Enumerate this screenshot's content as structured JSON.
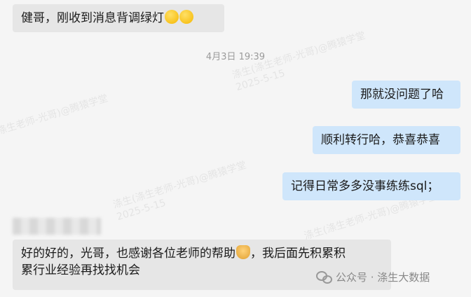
{
  "messages": [
    {
      "text": "健哥，刚收到消息背调绿灯",
      "emoji": [
        "laugh-cry-emoji",
        "laugh-cry-emoji"
      ]
    },
    {
      "text": "那就没问题了哈"
    },
    {
      "text": "顺利转行哈，恭喜恭喜"
    },
    {
      "text": "记得日常多多没事练练sql；"
    },
    {
      "line1": "好的好的，光哥，也感谢各位老师的帮助",
      "emoji": "pray-emoji",
      "line1b": "，我后面先积累积",
      "line2": "累行业经验再找找机会"
    }
  ],
  "timestamp": "4月3日 19:39",
  "watermark": {
    "name": "涤生(涤生老师-光哥)@腾猿学堂",
    "date": "2025-5-15"
  },
  "brand": {
    "text": "公众号 · 涤生大数据"
  },
  "colors": {
    "incoming": "#e6e6e6",
    "outgoing": "#cfe6fb",
    "background": "#f5f5f5"
  }
}
